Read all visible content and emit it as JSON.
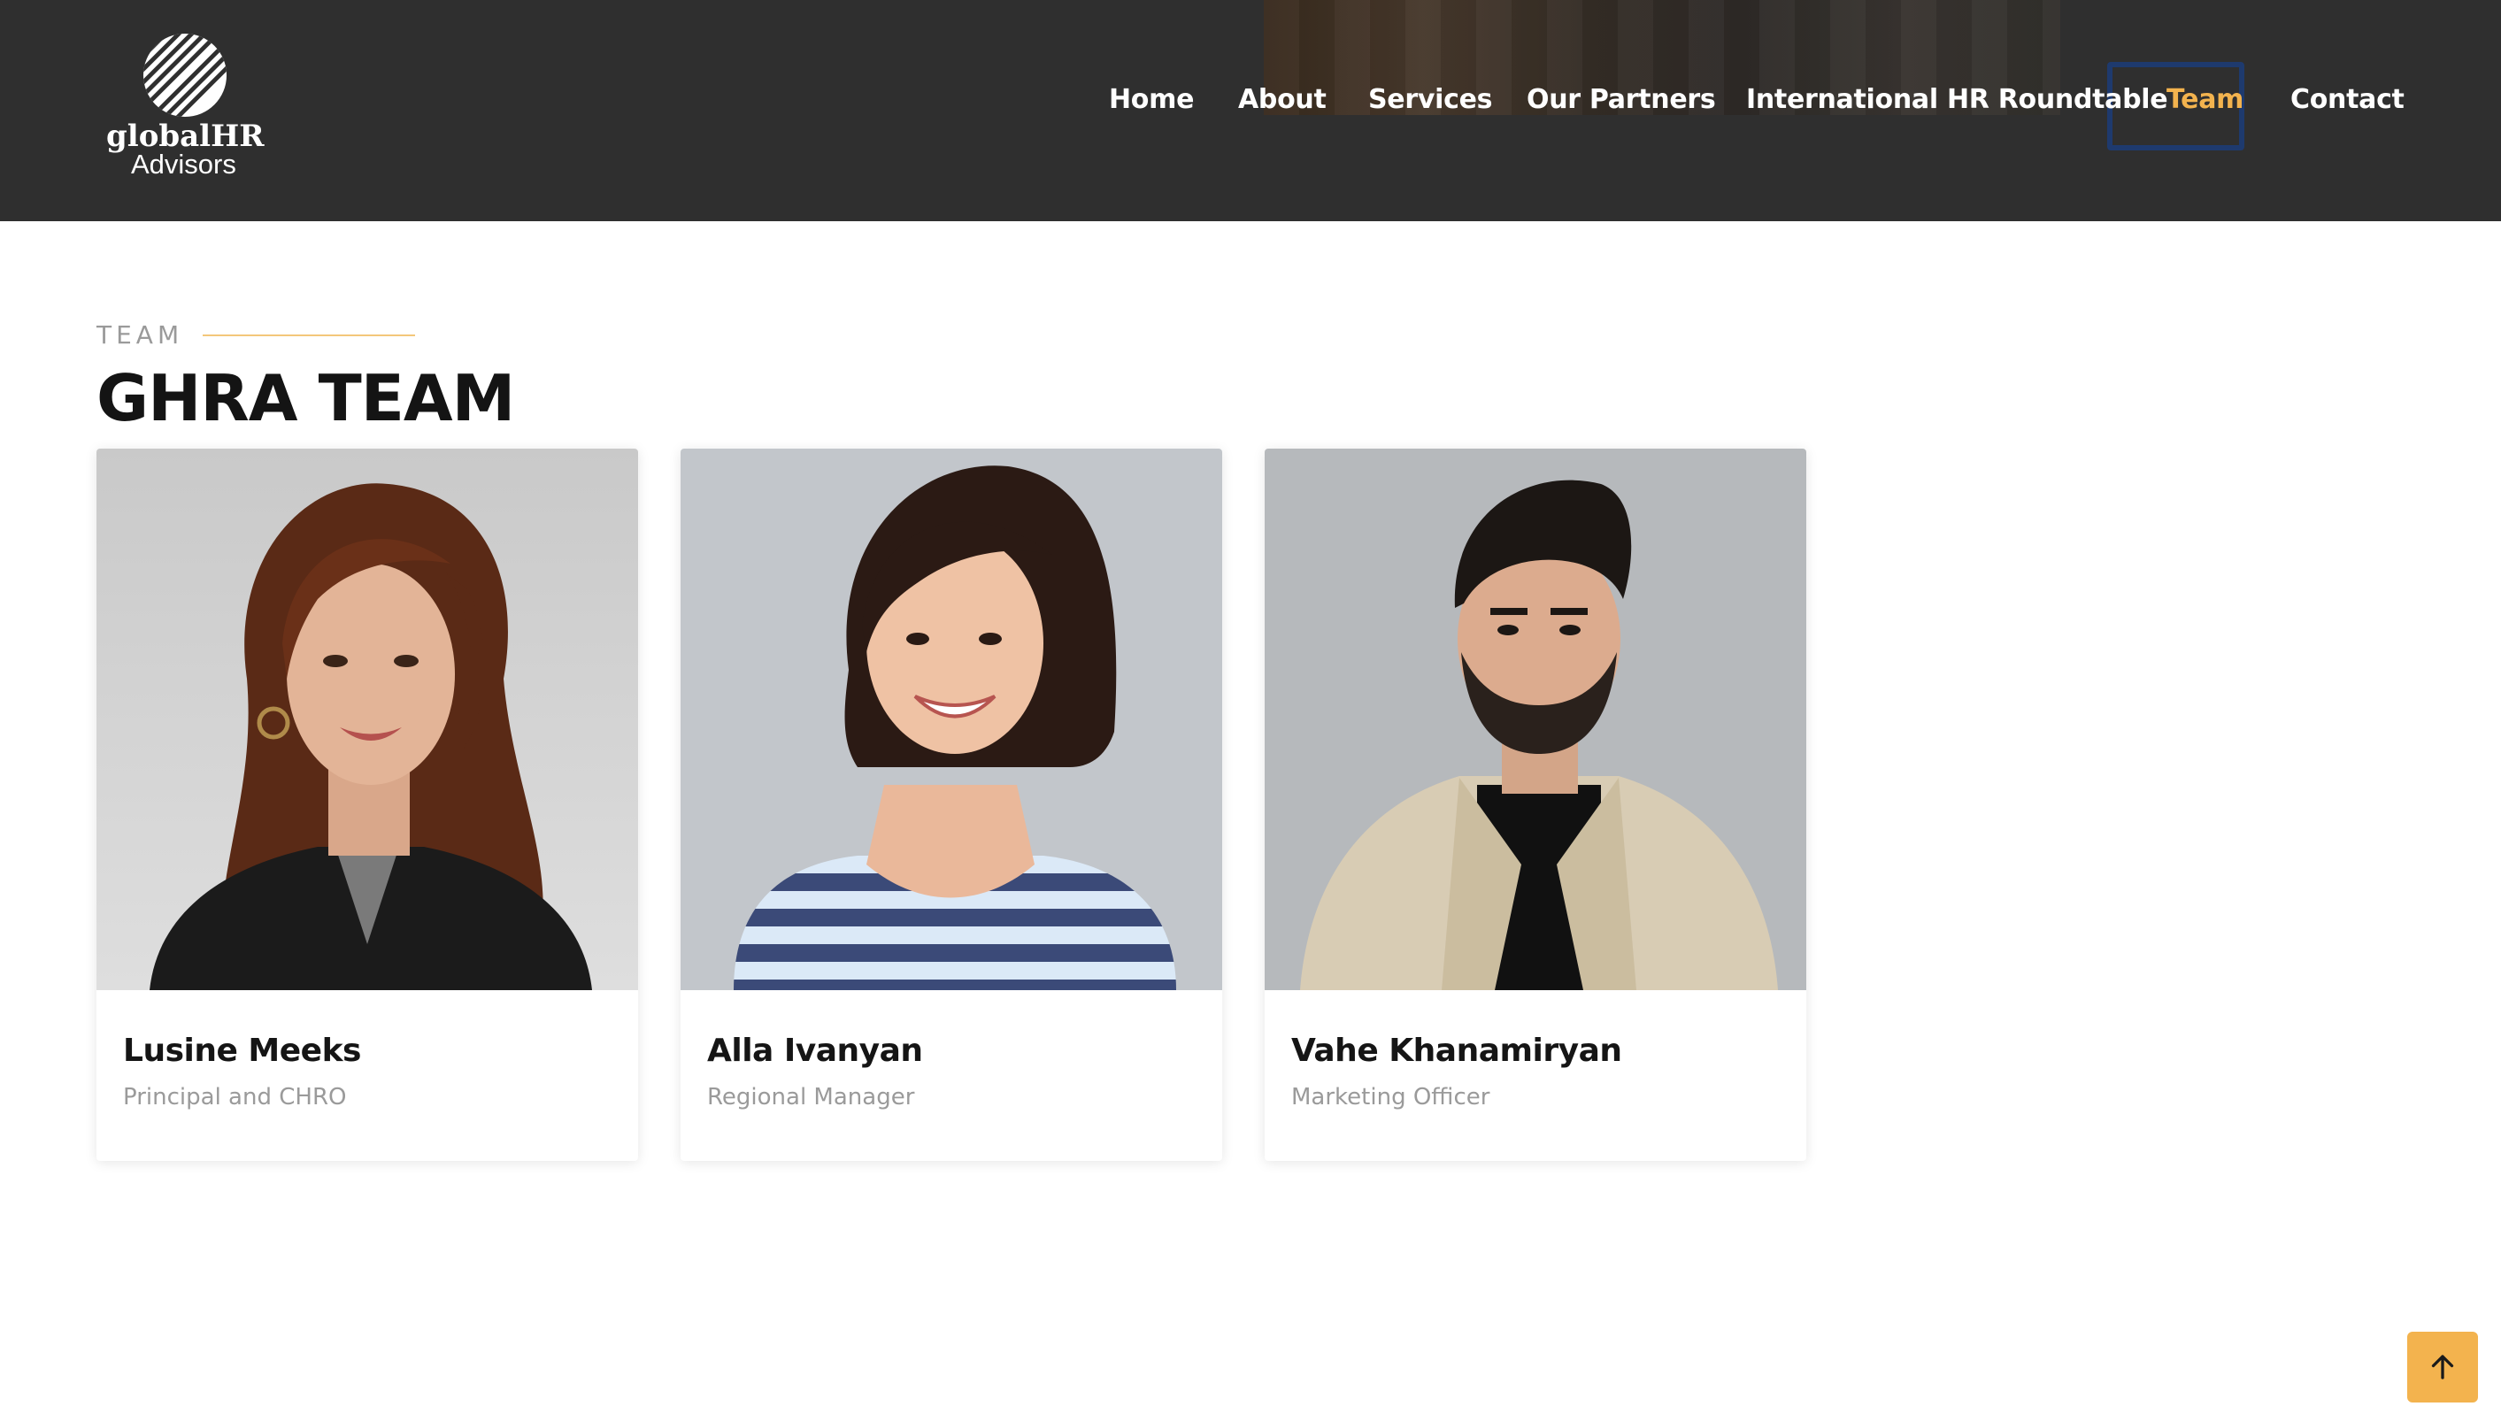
{
  "header": {
    "logo": {
      "line1": "globalHR",
      "line2": "Advisors"
    },
    "nav": [
      {
        "label": "Home"
      },
      {
        "label": "About"
      },
      {
        "label": "Services"
      },
      {
        "label": "Our Partners"
      },
      {
        "label": "International HR Roundtable"
      },
      {
        "label": "Team",
        "active": true
      },
      {
        "label": "Contact"
      }
    ]
  },
  "section": {
    "eyebrow": "TEAM",
    "title": "GHRA TEAM"
  },
  "team": [
    {
      "name": "Lusine Meeks",
      "role": "Principal and CHRO"
    },
    {
      "name": "Alla Ivanyan",
      "role": "Regional Manager"
    },
    {
      "name": "Vahe Khanamiryan",
      "role": "Marketing Officer"
    }
  ],
  "colors": {
    "header_bg": "#2f2f2f",
    "accent": "#f3b34e",
    "focus_ring": "#1e3a6e"
  },
  "icons": {
    "scroll_top": "arrow-up-icon"
  }
}
